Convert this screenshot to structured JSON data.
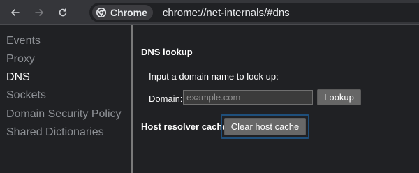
{
  "toolbar": {
    "back_icon": "arrow-left-icon",
    "forward_icon": "arrow-right-icon",
    "reload_icon": "reload-icon",
    "chrome_icon": "chrome-icon",
    "chip_label": "Chrome",
    "url": "chrome://net-internals/#dns"
  },
  "sidebar": {
    "items": [
      {
        "label": "Events"
      },
      {
        "label": "Proxy"
      },
      {
        "label": "DNS"
      },
      {
        "label": "Sockets"
      },
      {
        "label": "Domain Security Policy"
      },
      {
        "label": "Shared Dictionaries"
      }
    ]
  },
  "dns": {
    "section_title": "DNS lookup",
    "instructions": "Input a domain name to look up:",
    "domain_label": "Domain:",
    "domain_value": "",
    "domain_placeholder": "example.com",
    "lookup_button": "Lookup",
    "cache_label": "Host resolver cache",
    "clear_cache_button": "Clear host cache"
  },
  "colors": {
    "background": "#202124",
    "toolbar_background": "#35363a",
    "sidebar_text": "#8e9196",
    "active_text": "#ffffff",
    "button_background": "#686868",
    "focus_ring": "#1f4f7b"
  }
}
